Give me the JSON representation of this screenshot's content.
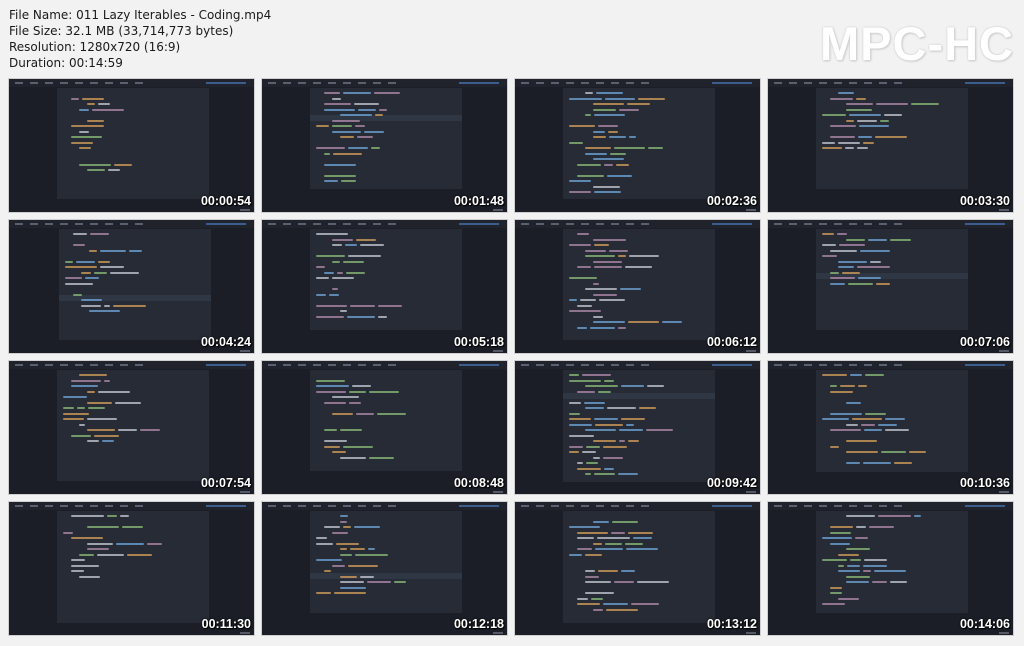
{
  "info": {
    "file_name": "File Name: 011 Lazy Iterables - Coding.mp4",
    "file_size": "File Size: 32.1 MB (33,714,773 bytes)",
    "resolution": "Resolution: 1280x720 (16:9)",
    "duration": "Duration: 00:14:59"
  },
  "logo": "MPC-HC",
  "colors": {
    "page_bg": "#f2f2f2",
    "thumb_bg": "#1b1e26",
    "editor_bg": "#262b35",
    "code_blue": "#6fa8dc",
    "code_green": "#8fbf7a",
    "code_orange": "#d8a15b",
    "code_white": "#c7ccd6",
    "code_purple": "#b48ead"
  },
  "thumbnails": [
    {
      "time": "00:00:54"
    },
    {
      "time": "00:01:48"
    },
    {
      "time": "00:02:36"
    },
    {
      "time": "00:03:30"
    },
    {
      "time": "00:04:24"
    },
    {
      "time": "00:05:18"
    },
    {
      "time": "00:06:12"
    },
    {
      "time": "00:07:06"
    },
    {
      "time": "00:07:54"
    },
    {
      "time": "00:08:48"
    },
    {
      "time": "00:09:42"
    },
    {
      "time": "00:10:36"
    },
    {
      "time": "00:11:30"
    },
    {
      "time": "00:12:18"
    },
    {
      "time": "00:13:12"
    },
    {
      "time": "00:14:06"
    }
  ]
}
